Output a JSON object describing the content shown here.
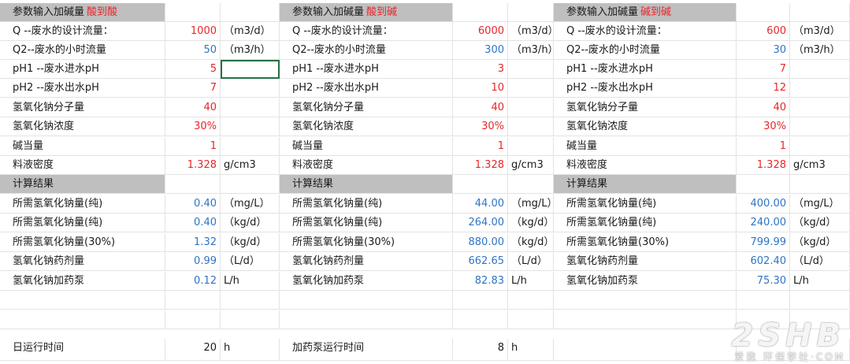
{
  "sections": [
    {
      "title": "参数输入加碱量",
      "mode": "酸到酸",
      "inputs": [
        {
          "label": "Q --废水的设计流量：",
          "value": "1000",
          "unit": "（m3/d）"
        },
        {
          "label": "Q2--废水的小时流量",
          "value": "50",
          "unit": "（m3/h）",
          "blue": true
        },
        {
          "label": "pH1 --废水进水pH",
          "value": "5",
          "unit": ""
        },
        {
          "label": "pH2 --废水出水pH",
          "value": "7",
          "unit": ""
        },
        {
          "label": "氢氧化钠分子量",
          "value": "40",
          "unit": ""
        },
        {
          "label": "氢氧化钠浓度",
          "value": "30%",
          "unit": ""
        },
        {
          "label": "碱当量",
          "value": "1",
          "unit": ""
        },
        {
          "label": "料液密度",
          "value": "1.328",
          "unit": "g/cm3"
        }
      ],
      "results_title": "计算结果",
      "results": [
        {
          "label": "所需氢氧化钠量(纯)",
          "value": "0.40",
          "unit": "（mg/L）"
        },
        {
          "label": "所需氢氧化钠量(纯)",
          "value": "0.40",
          "unit": "（kg/d）"
        },
        {
          "label": "所需氢氧化钠量(30%)",
          "value": "1.32",
          "unit": "（kg/d）"
        },
        {
          "label": "氢氧化钠药剂量",
          "value": "0.99",
          "unit": "（L/d）"
        },
        {
          "label": "氢氧化钠加药泵",
          "value": "0.12",
          "unit": "L/h"
        }
      ],
      "footer": {
        "label": "日运行时间",
        "value": "20",
        "unit": "h"
      }
    },
    {
      "title": "参数输入加碱量",
      "mode": "酸到碱",
      "inputs": [
        {
          "label": "Q --废水的设计流量：",
          "value": "6000",
          "unit": "（m3/d）"
        },
        {
          "label": "Q2--废水的小时流量",
          "value": "300",
          "unit": "（m3/h）",
          "blue": true
        },
        {
          "label": "pH1 --废水进水pH",
          "value": "3",
          "unit": ""
        },
        {
          "label": "pH2 --废水出水pH",
          "value": "10",
          "unit": ""
        },
        {
          "label": "氢氧化钠分子量",
          "value": "40",
          "unit": ""
        },
        {
          "label": "氢氧化钠浓度",
          "value": "30%",
          "unit": ""
        },
        {
          "label": "碱当量",
          "value": "1",
          "unit": ""
        },
        {
          "label": "料液密度",
          "value": "1.328",
          "unit": "g/cm3"
        }
      ],
      "results_title": "计算结果",
      "results": [
        {
          "label": "所需氢氧化钠量(纯)",
          "value": "44.00",
          "unit": "（mg/L）"
        },
        {
          "label": "所需氢氧化钠量(纯)",
          "value": "264.00",
          "unit": "（kg/d）"
        },
        {
          "label": "所需氢氧化钠量(30%)",
          "value": "880.00",
          "unit": "（kg/d）"
        },
        {
          "label": "氢氧化钠药剂量",
          "value": "662.65",
          "unit": "（L/d）"
        },
        {
          "label": "氢氧化钠加药泵",
          "value": "82.83",
          "unit": "L/h"
        }
      ],
      "footer": {
        "label": "加药泵运行时间",
        "value": "8",
        "unit": "h"
      }
    },
    {
      "title": "参数输入加碱量",
      "mode": "碱到碱",
      "inputs": [
        {
          "label": "Q --废水的设计流量：",
          "value": "600",
          "unit": "（m3/d）"
        },
        {
          "label": "Q2--废水的小时流量",
          "value": "30",
          "unit": "（m3/h）",
          "blue": true
        },
        {
          "label": "pH1 --废水进水pH",
          "value": "7",
          "unit": ""
        },
        {
          "label": "pH2 --废水出水pH",
          "value": "12",
          "unit": ""
        },
        {
          "label": "氢氧化钠分子量",
          "value": "40",
          "unit": ""
        },
        {
          "label": "氢氧化钠浓度",
          "value": "30%",
          "unit": ""
        },
        {
          "label": "碱当量",
          "value": "1",
          "unit": ""
        },
        {
          "label": "料液密度",
          "value": "1.328",
          "unit": "g/cm3"
        }
      ],
      "results_title": "计算结果",
      "results": [
        {
          "label": "所需氢氧化钠量(纯)",
          "value": "400.00",
          "unit": "（mg/L）"
        },
        {
          "label": "所需氢氧化钠量(纯)",
          "value": "240.00",
          "unit": "（kg/d）"
        },
        {
          "label": "所需氢氧化钠量(30%)",
          "value": "799.99",
          "unit": "（kg/d）"
        },
        {
          "label": "氢氧化钠药剂量",
          "value": "602.40",
          "unit": "（L/d）"
        },
        {
          "label": "氢氧化钠加药泵",
          "value": "75.30",
          "unit": "L/h"
        }
      ],
      "footer": null
    }
  ],
  "colors": {
    "input_value": "#e8262a",
    "result_value": "#2e75c6",
    "header_bg": "#bfbfbf",
    "mode_text": "#e8262a"
  },
  "watermark": {
    "big": "2SHB",
    "small": "环保学社·COM",
    "badge": "爱我"
  }
}
